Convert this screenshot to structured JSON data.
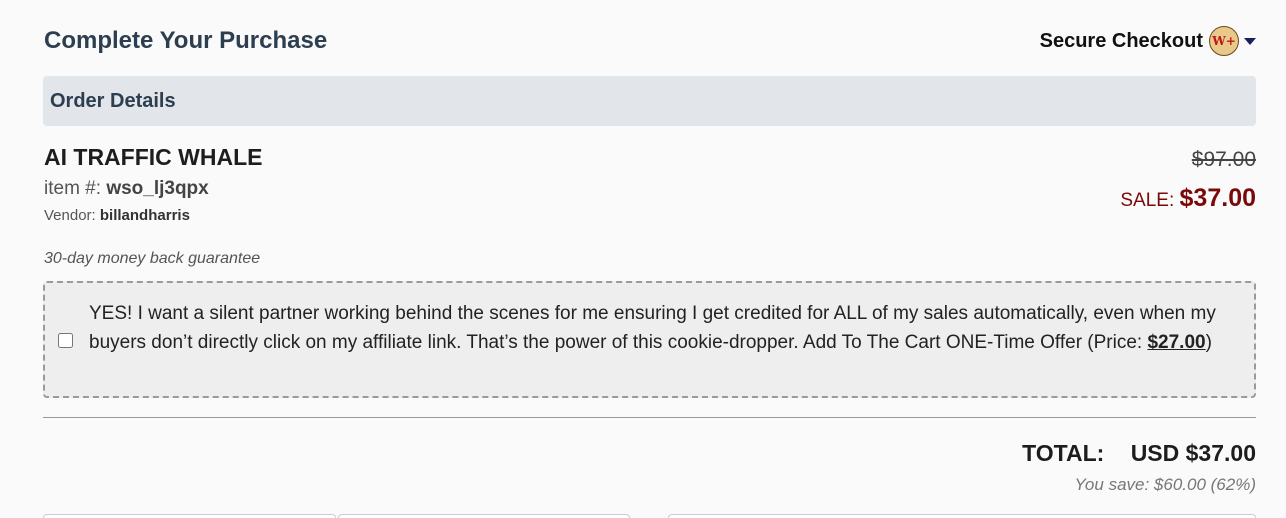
{
  "header": {
    "title": "Complete Your Purchase",
    "secure_label": "Secure Checkout",
    "logo_text": "W+"
  },
  "order": {
    "section_title": "Order Details",
    "item_name": "AI TRAFFIC WHALE",
    "item_id_label": "item #:",
    "item_id": "wso_lj3qpx",
    "vendor_label": "Vendor:",
    "vendor": "billandharris",
    "original_price": "$97.00",
    "sale_label": "SALE:",
    "sale_price": "$37.00",
    "guarantee": "30-day money back guarantee"
  },
  "offer": {
    "text": "YES! I want a silent partner working behind the scenes for me ensuring I get credited for ALL of my sales automatically, even when my buyers don’t directly click on my affiliate link. That’s the power of this cookie-dropper. Add To The Cart ONE-Time Offer (Price: ",
    "price": "$27.00",
    "suffix": ")",
    "checked": false
  },
  "summary": {
    "total_label": "TOTAL:",
    "total_value": "USD $37.00",
    "savings": "You save: $60.00 (62%)"
  }
}
